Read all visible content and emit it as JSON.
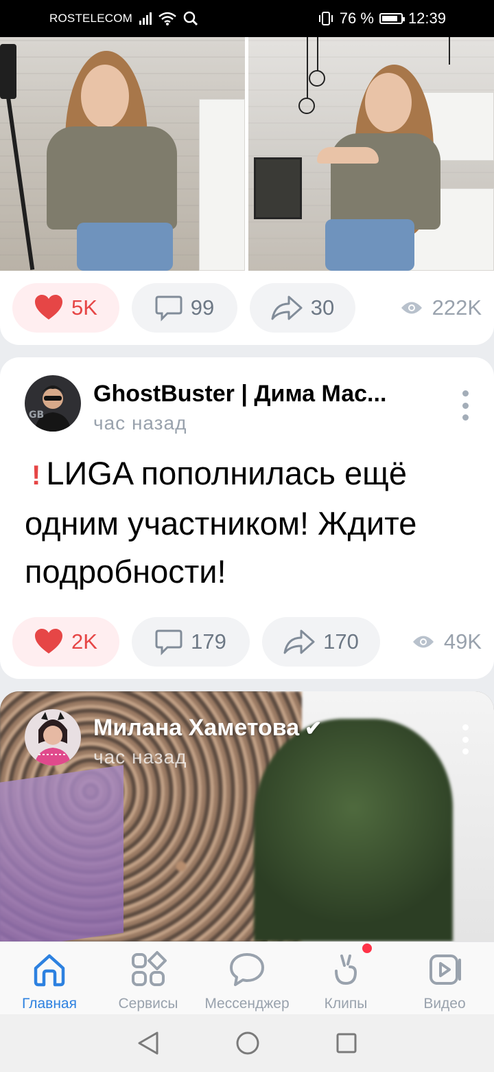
{
  "status_bar": {
    "carrier": "ROSTELECOM",
    "battery": "76 %",
    "time": "12:39"
  },
  "feed": {
    "photo_post": {
      "likes": "5K",
      "comments": "99",
      "shares": "30",
      "views": "222K"
    },
    "text_post": {
      "author": "GhostBuster | Дима Мас...",
      "time": "час назад",
      "text": "LИGA пополнилась ещё одним участником! Ждите подробности!",
      "likes": "2K",
      "comments": "179",
      "shares": "170",
      "views": "49K"
    },
    "video_post": {
      "author": "Милана Хаметова",
      "time": "час назад"
    }
  },
  "tabbar": {
    "items": [
      {
        "label": "Главная",
        "icon": "home-icon",
        "active": true
      },
      {
        "label": "Сервисы",
        "icon": "services-icon"
      },
      {
        "label": "Мессенджер",
        "icon": "messenger-icon"
      },
      {
        "label": "Клипы",
        "icon": "clips-icon",
        "badge": true
      },
      {
        "label": "Видео",
        "icon": "video-icon"
      }
    ]
  },
  "colors": {
    "accent": "#2d81e0",
    "like": "#e64646",
    "muted": "#99a2ad"
  }
}
